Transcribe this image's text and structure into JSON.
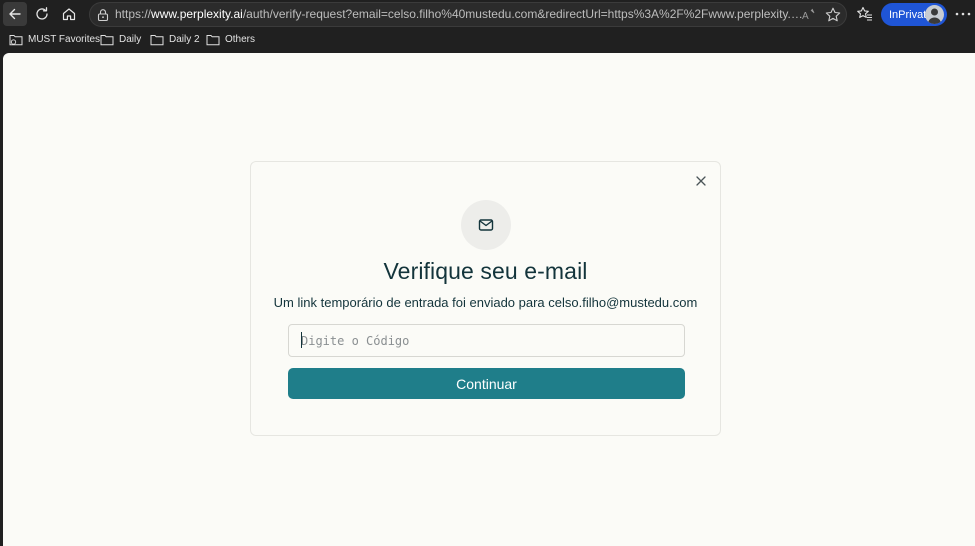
{
  "browser": {
    "url_prefix": "https://",
    "url_domain": "www.perplexity.ai",
    "url_rest": "/auth/verify-request?email=celso.filho%40mustedu.com&redirectUrl=https%3A%2F%2Fwww.perplexity.ai%2F%3Flogi...",
    "inprivate_label": "InPrivate",
    "accent_color": "#1f55d6"
  },
  "bookmarks": [
    {
      "label": "MUST Favorites",
      "icon": "favorites-folder-icon"
    },
    {
      "label": "Daily",
      "icon": "folder-icon"
    },
    {
      "label": "Daily 2",
      "icon": "folder-icon"
    },
    {
      "label": "Others",
      "icon": "folder-icon"
    }
  ],
  "dialog": {
    "icon": "mail-icon",
    "title": "Verifique seu e-mail",
    "subtitle": "Um link temporário de entrada foi enviado para celso.filho@mustedu.com",
    "code_placeholder": "Digite o Código",
    "code_value": "",
    "continue_label": "Continuar",
    "button_color": "#1f7e8a"
  }
}
